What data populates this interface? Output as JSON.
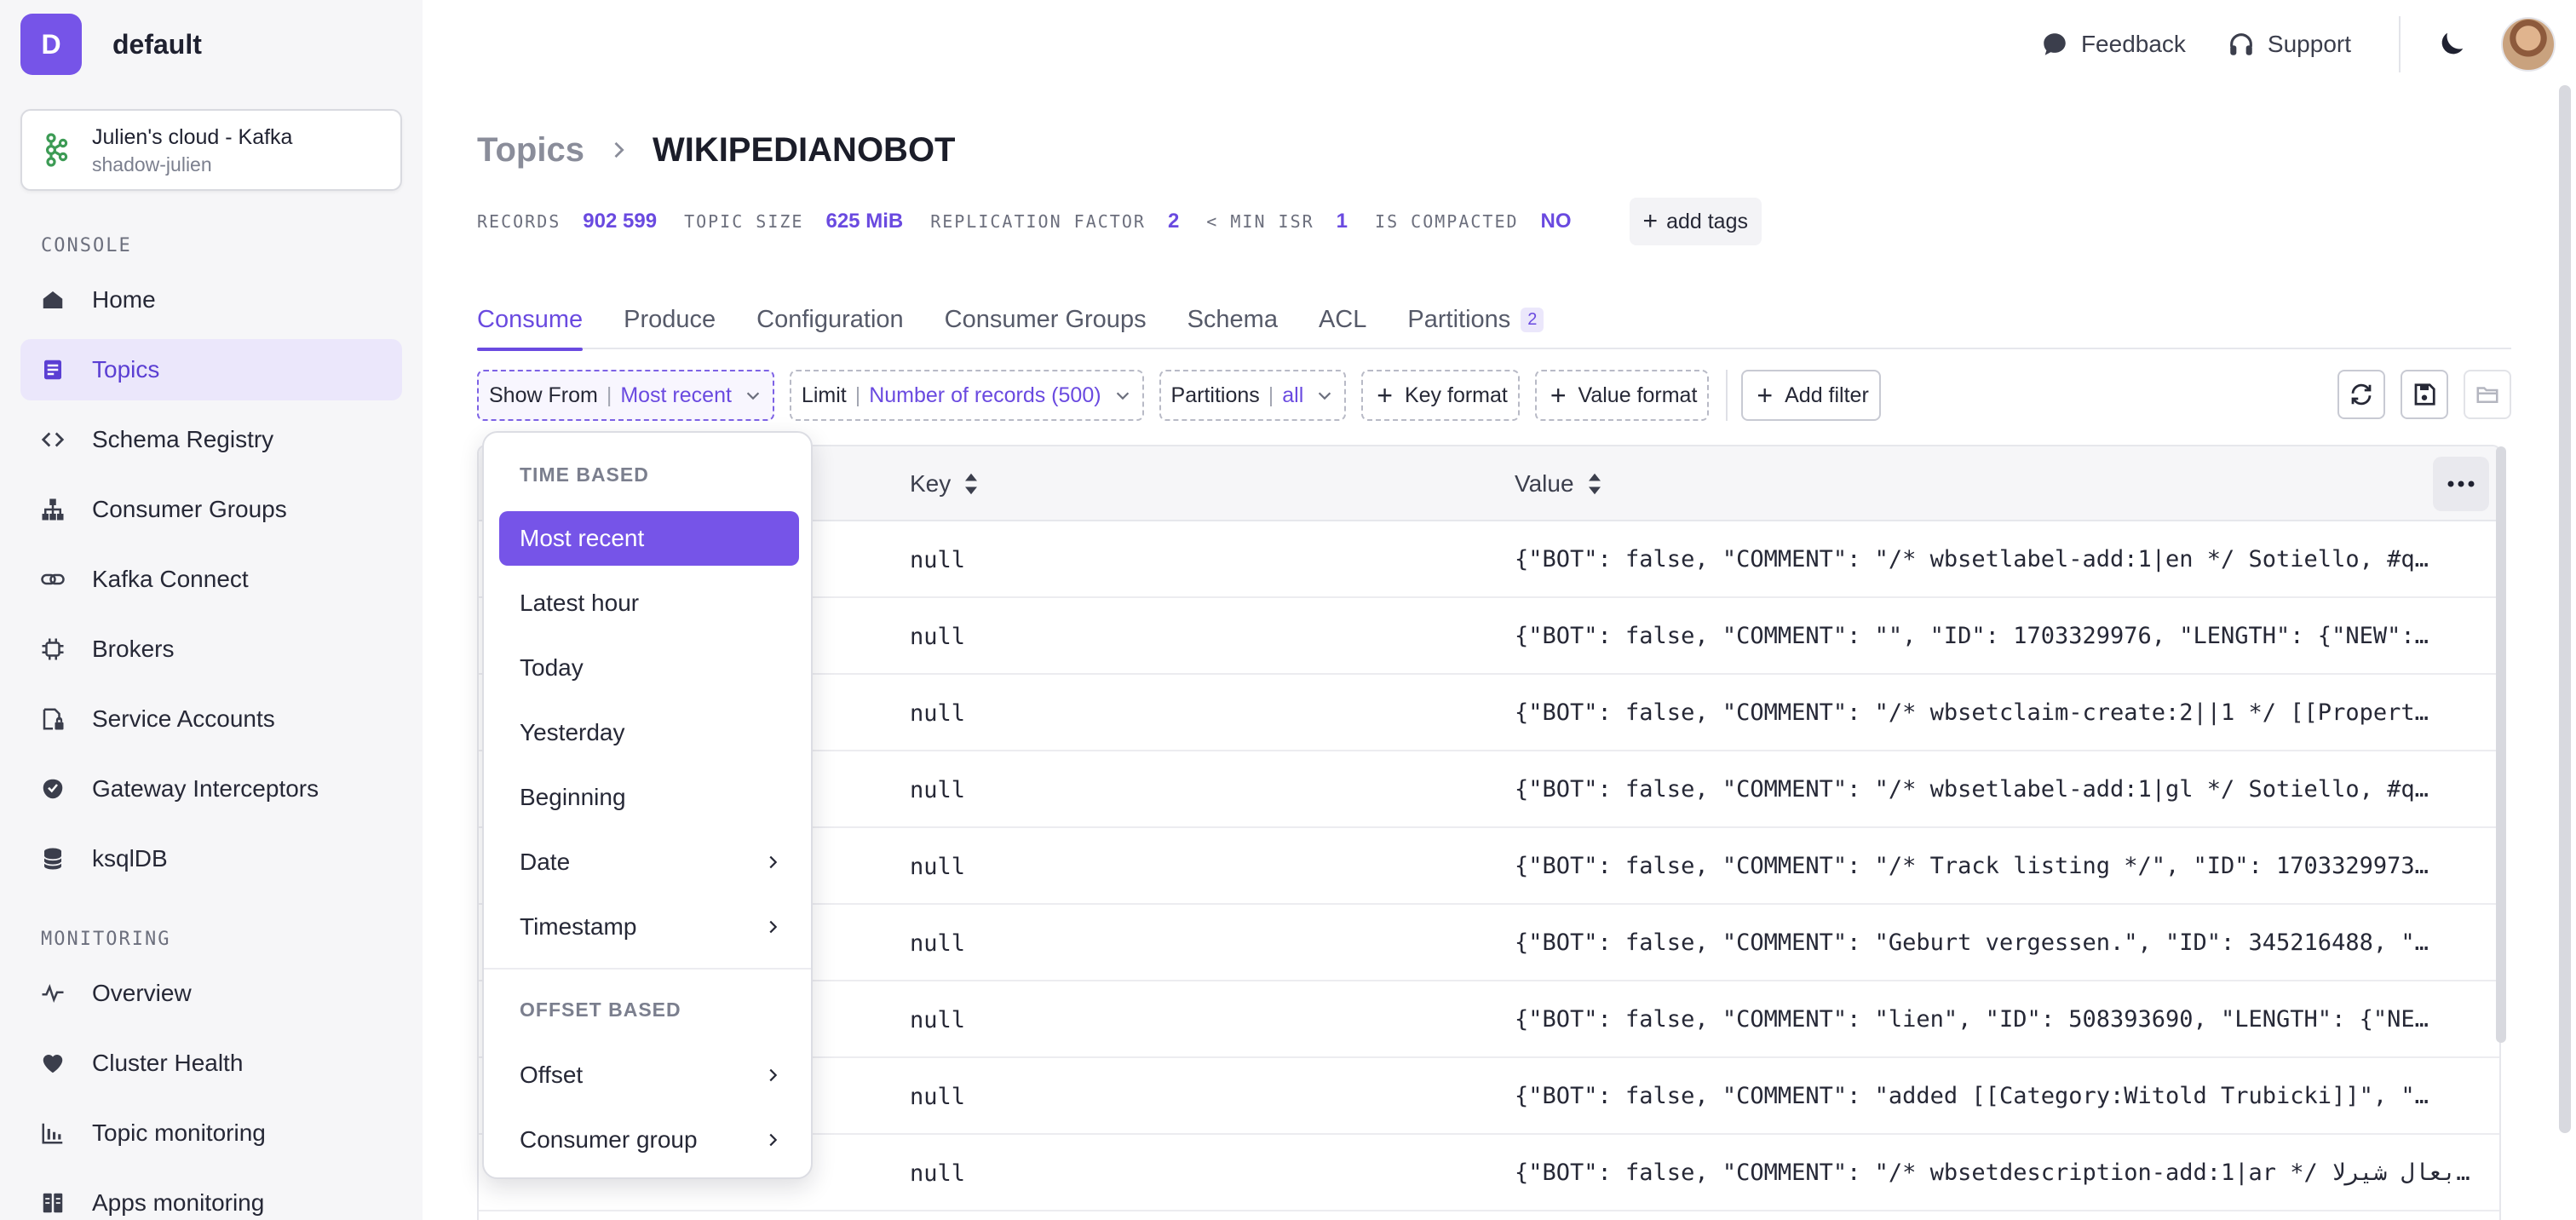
{
  "workspace": {
    "initial": "D",
    "name": "default"
  },
  "cluster": {
    "name": "Julien's cloud - Kafka",
    "sub": "shadow-julien"
  },
  "sidebar": {
    "console_label": "CONSOLE",
    "console_items": [
      {
        "label": "Home",
        "icon": "home-icon"
      },
      {
        "label": "Topics",
        "icon": "topics-icon",
        "active": true
      },
      {
        "label": "Schema Registry",
        "icon": "code-icon"
      },
      {
        "label": "Consumer Groups",
        "icon": "hierarchy-icon"
      },
      {
        "label": "Kafka Connect",
        "icon": "link-icon"
      },
      {
        "label": "Brokers",
        "icon": "chip-icon"
      },
      {
        "label": "Service Accounts",
        "icon": "id-lock-icon"
      },
      {
        "label": "Gateway Interceptors",
        "icon": "shield-icon"
      },
      {
        "label": "ksqlDB",
        "icon": "database-icon"
      }
    ],
    "monitoring_label": "MONITORING",
    "monitoring_items": [
      {
        "label": "Overview",
        "icon": "pulse-icon"
      },
      {
        "label": "Cluster Health",
        "icon": "heart-icon"
      },
      {
        "label": "Topic monitoring",
        "icon": "bar-chart-icon"
      },
      {
        "label": "Apps monitoring",
        "icon": "apps-icon"
      }
    ]
  },
  "topbar": {
    "feedback": "Feedback",
    "support": "Support"
  },
  "breadcrumb": {
    "parent": "Topics",
    "current": "WIKIPEDIANOBOT"
  },
  "stats": {
    "records_label": "RECORDS",
    "records": "902 599",
    "size_label": "TOPIC SIZE",
    "size": "625 MiB",
    "replication_label": "REPLICATION FACTOR",
    "replication": "2",
    "isr_label": "< MIN ISR",
    "isr": "1",
    "compacted_label": "IS COMPACTED",
    "compacted": "NO",
    "add_tags": "add tags"
  },
  "tabs": [
    "Consume",
    "Produce",
    "Configuration",
    "Consumer Groups",
    "Schema",
    "ACL",
    "Partitions"
  ],
  "partitions_badge": "2",
  "filters": {
    "show_from_label": "Show From",
    "show_from_value": "Most recent",
    "limit_label": "Limit",
    "limit_value": "Number of records (500)",
    "partitions_label": "Partitions",
    "partitions_value": "all",
    "key_format": "Key format",
    "value_format": "Value format",
    "add_filter": "Add filter"
  },
  "table": {
    "key_header": "Key",
    "value_header": "Value",
    "rows": [
      {
        "ts": "",
        "key": "null",
        "value": "{\"BOT\": false, \"COMMENT\": \"/* wbsetlabel-add:1|en */ Sotiello, #q…"
      },
      {
        "ts": "",
        "key": "null",
        "value": "{\"BOT\": false, \"COMMENT\": \"\", \"ID\": 1703329976, \"LENGTH\": {\"NEW\":…"
      },
      {
        "ts": "",
        "key": "null",
        "value": "{\"BOT\": false, \"COMMENT\": \"/* wbsetclaim-create:2||1 */ [[Propert…"
      },
      {
        "ts": "",
        "key": "null",
        "value": "{\"BOT\": false, \"COMMENT\": \"/* wbsetlabel-add:1|gl */ Sotiello, #q…"
      },
      {
        "ts": "",
        "key": "null",
        "value": "{\"BOT\": false, \"COMMENT\": \"/* Track listing */\", \"ID\": 1703329973…"
      },
      {
        "ts": "",
        "key": "null",
        "value": "{\"BOT\": false, \"COMMENT\": \"Geburt vergessen.\", \"ID\": 345216488, \"…"
      },
      {
        "ts": "",
        "key": "null",
        "value": "{\"BOT\": false, \"COMMENT\": \"lien\", \"ID\": 508393690, \"LENGTH\": {\"NE…"
      },
      {
        "ts": "",
        "key": "null",
        "value": "{\"BOT\": false, \"COMMENT\": \"added [[Category:Witold Trubicki]]\", \"…"
      },
      {
        "ts": "",
        "key": "null",
        "value": "{\"BOT\": false, \"COMMENT\": \"/* wbsetdescription-add:1|ar */ بعال شيرلا…"
      }
    ]
  },
  "dropdown": {
    "time_label": "TIME BASED",
    "time_items": [
      "Most recent",
      "Latest hour",
      "Today",
      "Yesterday",
      "Beginning",
      "Date",
      "Timestamp"
    ],
    "offset_label": "OFFSET BASED",
    "offset_items": [
      "Offset",
      "Consumer group"
    ]
  },
  "colors": {
    "accent": "#6a4ae0",
    "accent_bg": "#ebe7fb",
    "avatar": "#7654e8"
  }
}
